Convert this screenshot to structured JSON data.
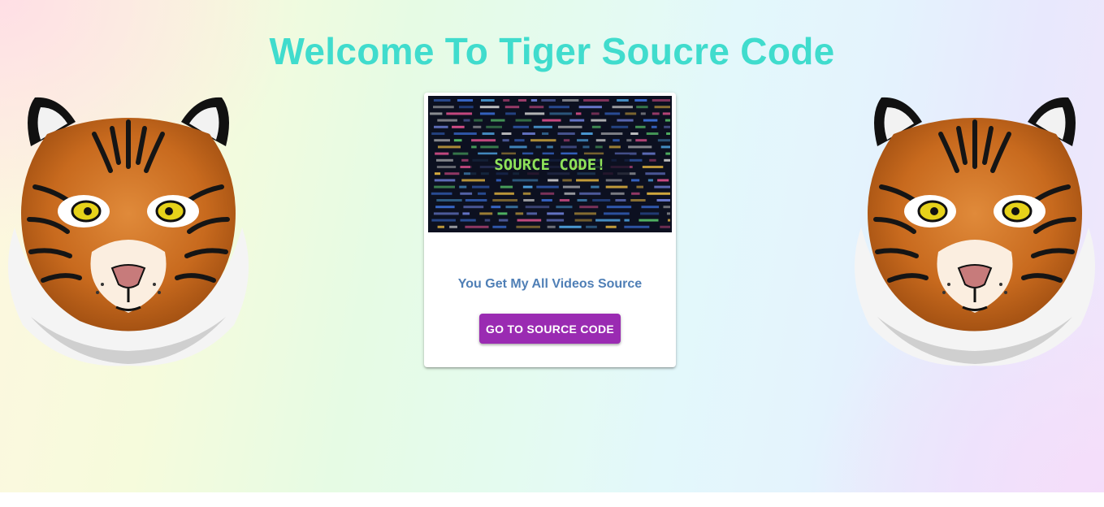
{
  "page": {
    "title": "Welcome To Tiger Soucre Code",
    "title_color": "#40dccd"
  },
  "card": {
    "image_text": "SOURCE CODE!",
    "description": "You Get My All Videos Source",
    "button_label": "GO TO SOURCE CODE",
    "button_color": "#9a2bb2",
    "text_color": "#4f7fb6"
  },
  "decorations": {
    "left_image": "tiger-face-icon",
    "right_image": "tiger-face-icon"
  }
}
